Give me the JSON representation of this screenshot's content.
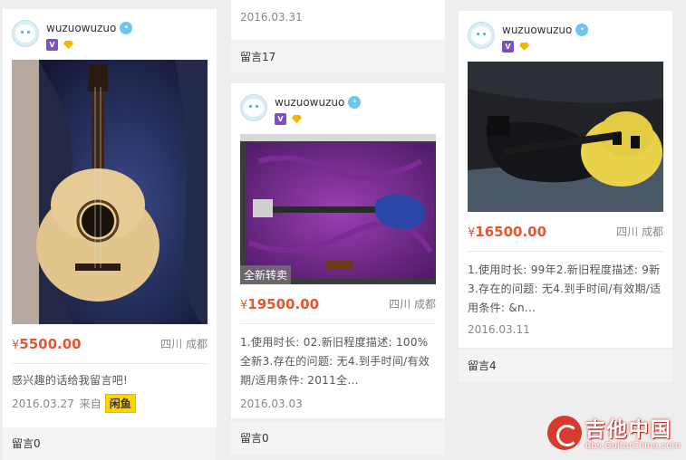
{
  "posts": [
    {
      "username": "wuzuowuzuo",
      "price_symbol": "¥",
      "price": "5500.00",
      "location": "四川 成都",
      "description": "感兴趣的话给我留言吧!",
      "date": "2016.03.27",
      "from_label": "来自",
      "app_tag": "闲鱼",
      "comments": "留言0",
      "image": "acoustic-guitar-photo"
    },
    {
      "username": "wuzuowuzuo",
      "price_symbol": "¥",
      "price": "19500.00",
      "location": "四川 成都",
      "badge": "全新转卖",
      "description": "1.使用时长: 02.新旧程度描述: 100%全新3.存在的问题: 无4.到手时间/有效期/适用条件: 2011全...",
      "date": "2016.03.03",
      "comments": "留言0",
      "image": "blue-electric-guitar-photo"
    },
    {
      "username": "wuzuowuzuo",
      "price_symbol": "¥",
      "price": "16500.00",
      "location": "四川 成都",
      "description": "1.使用时长: 99年2.新旧程度描述: 9新3.存在的问题: 无4.到手时间/有效期/适用条件: &n...",
      "date": "2016.03.11",
      "comments": "留言4",
      "image": "yellow-electric-guitar-photo"
    }
  ],
  "top_partial": {
    "date": "2016.03.31",
    "comments": "留言17"
  },
  "watermark": {
    "title": "吉他中国",
    "url": "bbs.GuitarChina.com"
  },
  "colors": {
    "price": "#e4572e",
    "background": "#eeeeee",
    "card": "#ffffff"
  }
}
